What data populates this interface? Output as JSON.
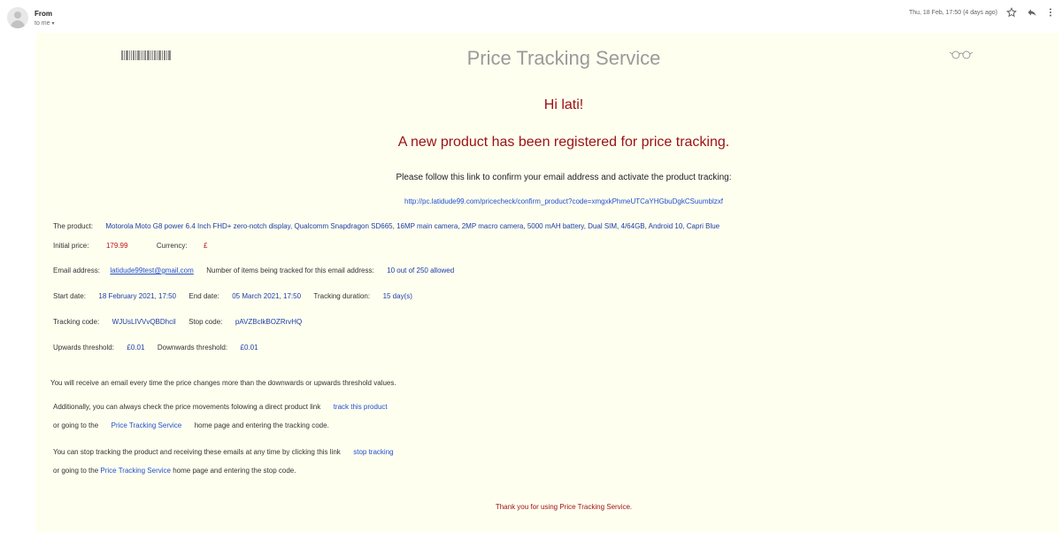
{
  "header": {
    "from_label": "From",
    "to_label": "to me",
    "to_caret": "▾",
    "date": "Thu, 18 Feb, 17:50 (4 days ago)",
    "icons": {
      "star": "star-icon",
      "reply": "reply-icon",
      "more": "more-vert-icon"
    }
  },
  "email": {
    "title": "Price Tracking Service",
    "greeting": "Hi lati!",
    "headline": "A new product has been registered for price tracking.",
    "instruction": "Please follow this link to confirm your email address and activate the product tracking:",
    "confirm_link": "http://pc.latidude99.com/pricecheck/confirm_product?code=xmgxkPhmeUTCaYHGbuDgkCSuumblzxf",
    "product": {
      "label": "The product:",
      "name": "Motorola Moto G8 power 6.4 Inch FHD+ zero-notch display, Qualcomm Snapdragon SD665, 16MP main camera, 2MP macro camera, 5000 mAH battery, Dual SIM, 4/64GB, Android 10, Capri Blue"
    },
    "price": {
      "label": "Initial price:",
      "value": "179.99",
      "currency_label": "Currency:",
      "currency": "£"
    },
    "email_row": {
      "label": "Email address:",
      "address": "latidude99test@gmail.com",
      "count_label": "Number of items being tracked for this email address:",
      "count": "10 out of 250 allowed"
    },
    "dates": {
      "start_label": "Start date:",
      "start": "18 February 2021, 17:50",
      "end_label": "End date:",
      "end": "05 March 2021, 17:50",
      "duration_label": "Tracking duration:",
      "duration": "15 day(s)"
    },
    "codes": {
      "tracking_label": "Tracking code:",
      "tracking": "WJUsLIVVvQBDhcil",
      "stop_label": "Stop code:",
      "stop": "pAVZBclkBOZRrvHQ"
    },
    "thresholds": {
      "up_label": "Upwards threshold:",
      "up": "£0.01",
      "down_label": "Downwards threshold:",
      "down": "£0.01"
    },
    "info": "You will receive an email every time the price changes more than the downwards or upwards threshold values.",
    "check": {
      "text": "Additionally, you can always check the price movements folowing a direct product link",
      "link": "track this product",
      "line2_pre": "or going to the",
      "service_link": "Price Tracking Service",
      "line2_post": "home page and entering the tracking code."
    },
    "stop": {
      "text": "You can stop tracking the product and receiving these emails at any time by clicking this link",
      "link": "stop tracking",
      "line2_pre": "or going to the",
      "service_link": "Price Tracking Service",
      "line2_post": "home page and entering the stop code."
    },
    "thanks": "Thank you for using Price Tracking Service."
  },
  "colors": {
    "accent_red": "#9c1010",
    "link_blue": "#1f4fcf",
    "body_bg": "#fffff0"
  }
}
